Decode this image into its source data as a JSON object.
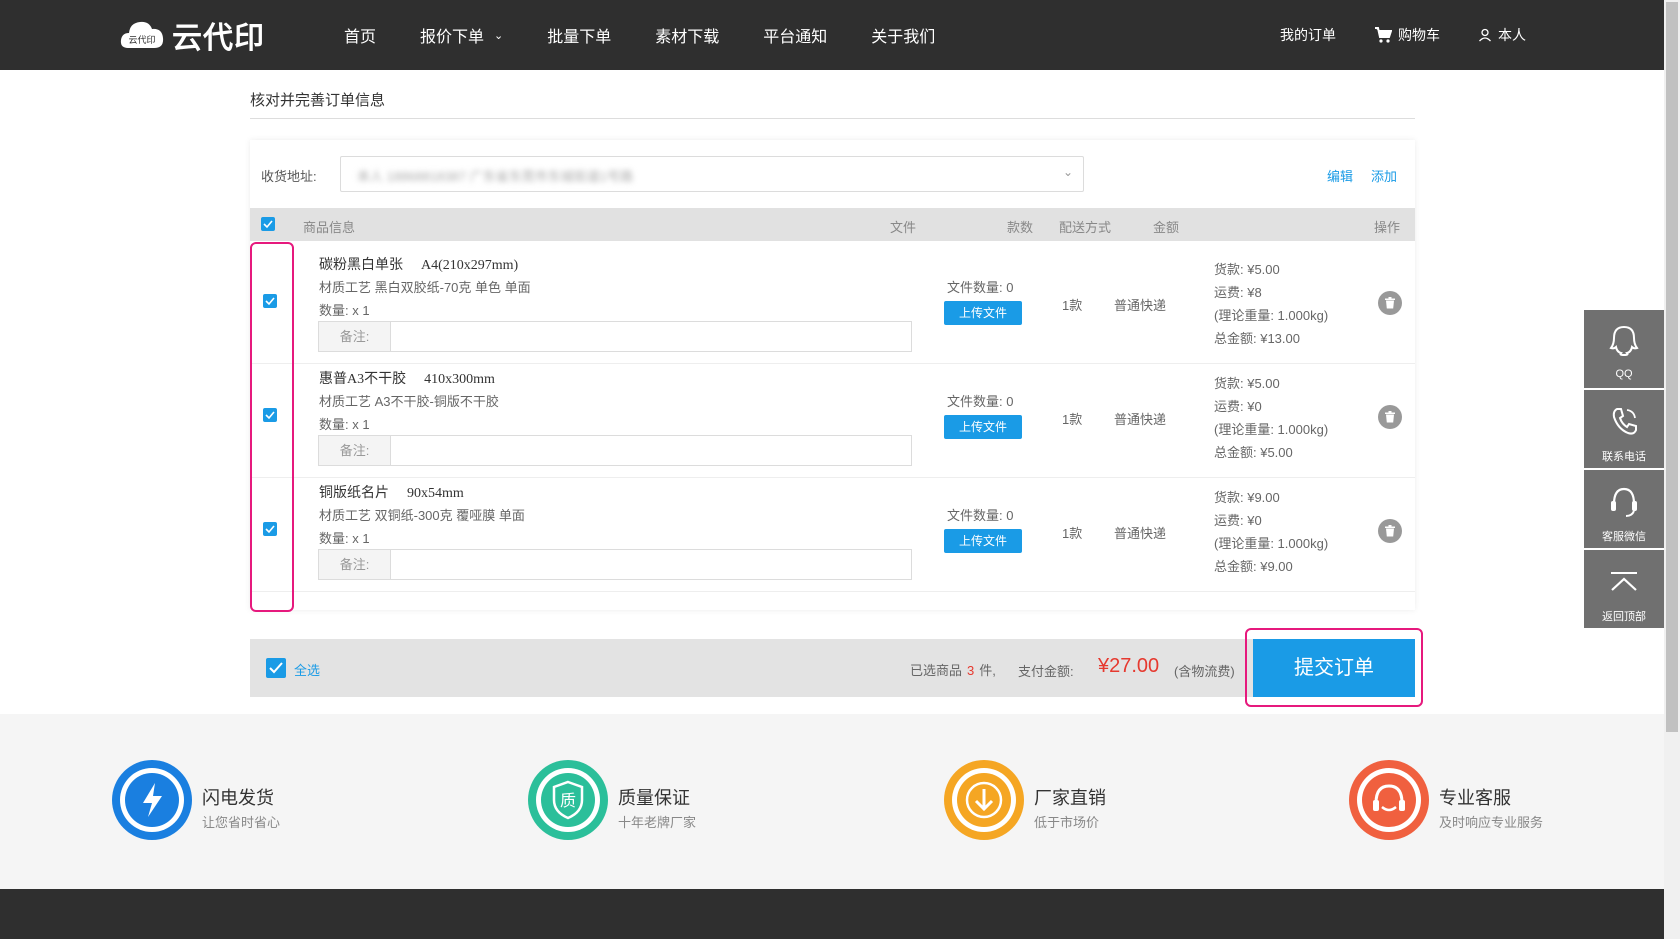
{
  "header": {
    "logo_text": "云代印",
    "logo_badge": "云代印",
    "nav": [
      "首页",
      "报价下单",
      "批量下单",
      "素材下载",
      "平台通知",
      "关于我们"
    ],
    "my_orders": "我的订单",
    "cart": "购物车",
    "user": "本人"
  },
  "page": {
    "title": "核对并完善订单信息"
  },
  "address": {
    "label": "收货地址:",
    "value": "本人 18868818387 广东省东莞市东城街道1号路",
    "edit": "编辑",
    "add": "添加"
  },
  "table": {
    "headers": {
      "product": "商品信息",
      "file": "文件",
      "count": "款数",
      "ship": "配送方式",
      "amount": "金额",
      "action": "操作"
    },
    "rows": [
      {
        "name": "碳粉黑白单张",
        "spec": "A4(210x297mm)",
        "material": "材质工艺  黑白双胶纸-70克 单色 单面",
        "qty": "数量: x 1",
        "remark_label": "备注:",
        "file_count": "文件数量: 0",
        "upload": "上传文件",
        "kuan": "1款",
        "ship": "普通快递",
        "goods": "货款: ¥5.00",
        "freight": "运费: ¥8",
        "weight": "(理论重量: 1.000kg)",
        "total": "总金额: ¥13.00",
        "checked": true
      },
      {
        "name": "惠普A3不干胶",
        "spec": "410x300mm",
        "material": "材质工艺  A3不干胶-铜版不干胶",
        "qty": "数量: x 1",
        "remark_label": "备注:",
        "file_count": "文件数量: 0",
        "upload": "上传文件",
        "kuan": "1款",
        "ship": "普通快递",
        "goods": "货款: ¥5.00",
        "freight": "运费: ¥0",
        "weight": "(理论重量: 1.000kg)",
        "total": "总金额: ¥5.00",
        "checked": true
      },
      {
        "name": "铜版纸名片",
        "spec": "90x54mm",
        "material": "材质工艺  双铜纸-300克 覆哑膜 单面",
        "qty": "数量: x 1",
        "remark_label": "备注:",
        "file_count": "文件数量: 0",
        "upload": "上传文件",
        "kuan": "1款",
        "ship": "普通快递",
        "goods": "货款: ¥9.00",
        "freight": "运费: ¥0",
        "weight": "(理论重量: 1.000kg)",
        "total": "总金额: ¥9.00",
        "checked": true
      }
    ]
  },
  "footer_bar": {
    "select_all": "全选",
    "selected_prefix": "已选商品",
    "selected_count": "3",
    "selected_suffix": "件,",
    "pay_label": "支付金额:",
    "pay_amount": "¥27.00",
    "pay_note": "(含物流费)",
    "submit": "提交订单"
  },
  "features": [
    {
      "title": "闪电发货",
      "sub": "让您省时省心",
      "color": "#1a7fe0",
      "icon": "lightning-icon"
    },
    {
      "title": "质量保证",
      "sub": "十年老牌厂家",
      "color": "#2bbf9a",
      "icon": "shield-icon",
      "glyph": "质"
    },
    {
      "title": "厂家直销",
      "sub": "低于市场价",
      "color": "#f5a623",
      "icon": "download-arrow-icon"
    },
    {
      "title": "专业客服",
      "sub": "及时响应专业服务",
      "color": "#f0603f",
      "icon": "headset-icon"
    }
  ],
  "side_tools": [
    {
      "label": "QQ",
      "icon": "qq-icon"
    },
    {
      "label": "联系电话",
      "icon": "phone-icon"
    },
    {
      "label": "客服微信",
      "icon": "headset-icon"
    },
    {
      "label": "返回顶部",
      "icon": "back-to-top-icon"
    }
  ],
  "colors": {
    "accent": "#1a9be6",
    "header_bg": "#2f2f2f",
    "price_red": "#e6392f",
    "highlight": "#e6197d"
  }
}
